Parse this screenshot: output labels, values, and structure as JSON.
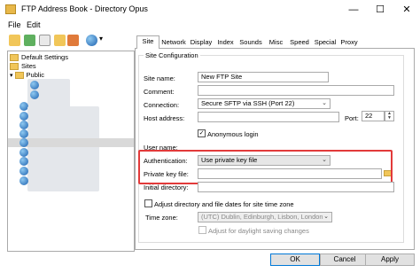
{
  "window": {
    "title": "FTP Address Book - Directory Opus",
    "minimize": "—",
    "maximize": "☐",
    "close": "✕"
  },
  "menu": [
    "File",
    "Edit"
  ],
  "toolbar": {
    "icons": [
      "new-folder-icon",
      "add-site-icon",
      "new-icon",
      "folder-open-icon",
      "delete-icon",
      "globe-icon"
    ],
    "dropdown": "▾"
  },
  "tree": {
    "default_settings": "Default Settings",
    "sites": "Sites",
    "public": "Public"
  },
  "tabs": [
    "Site",
    "Network",
    "Display",
    "Index",
    "Sounds",
    "Misc",
    "Speed",
    "Special",
    "Proxy"
  ],
  "group_title": "Site Configuration",
  "form": {
    "site_name_label": "Site name:",
    "site_name_value": "New FTP Site",
    "comment_label": "Comment:",
    "connection_label": "Connection:",
    "connection_value": "Secure SFTP via SSH (Port 22)",
    "host_label": "Host address:",
    "port_label": "Port:",
    "port_value": "22",
    "anon_label": "Anonymous login",
    "anon_checked": "✓",
    "user_label": "User name:",
    "auth_label": "Authentication:",
    "auth_value": "Use private key file",
    "keyfile_label": "Private key file:",
    "initdir_label": "Initial directory:",
    "adjust_label": "Adjust directory and file dates for site time zone",
    "tz_label": "Time zone:",
    "tz_value": "(UTC) Dublin, Edinburgh, Lisbon, London",
    "dst_label": "Adjust for daylight saving changes"
  },
  "buttons": {
    "ok": "OK",
    "cancel": "Cancel",
    "apply": "Apply"
  },
  "colors": {
    "highlight": "#e23a3a",
    "selection": "#cce8ff"
  }
}
